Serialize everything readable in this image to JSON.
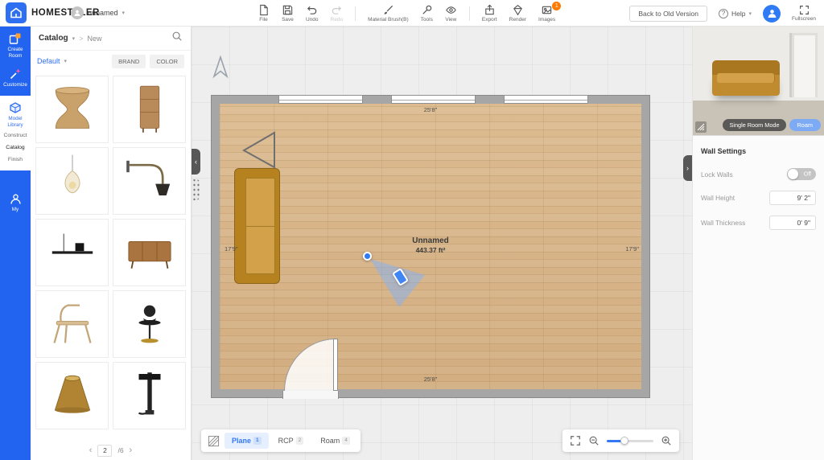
{
  "topbar": {
    "logo_text": "HOMESTYLER",
    "doc_name": "unnamed",
    "tools": [
      {
        "label": "File"
      },
      {
        "label": "Save"
      },
      {
        "label": "Undo"
      },
      {
        "label": "Redo"
      },
      {
        "label": "Material Brush(B)"
      },
      {
        "label": "Tools"
      },
      {
        "label": "View"
      },
      {
        "label": "Export"
      },
      {
        "label": "Render"
      },
      {
        "label": "Images",
        "badge": "1"
      }
    ],
    "back_button_label": "Back to Old Version",
    "help_label": "Help",
    "fullscreen_label": "Fullscreen"
  },
  "rail": {
    "items": [
      {
        "label": "Create Room"
      },
      {
        "label": "Customize"
      },
      {
        "label": "Model Library"
      },
      {
        "label": "Construct"
      },
      {
        "label": "Catalog"
      },
      {
        "label": "Finish"
      },
      {
        "label": "My"
      }
    ]
  },
  "catalog_panel": {
    "breadcrumb_root": "Catalog",
    "breadcrumb_sep": ">",
    "breadcrumb_current": "New",
    "sort_label": "Default",
    "tab_brand": "BRAND",
    "tab_color": "COLOR",
    "item_names": [
      "hourglass-rattan-stool",
      "tall-wood-cabinet",
      "glass-pendant-lamp",
      "brass-arm-wall-lamp",
      "black-linear-ceiling-lamp",
      "walnut-sideboard",
      "light-wood-chair",
      "sculpture-side-table",
      "bronze-cone-stool",
      "black-industrial-wall-lamp"
    ],
    "pagination": {
      "prev": "‹",
      "page": "2",
      "total": "/6",
      "next": "›"
    }
  },
  "canvas": {
    "room_name": "Unnamed",
    "room_area": "443.37 ft²",
    "dim_top": "25'8\"",
    "dim_bottom": "25'8\"",
    "dim_left": "17'9\"",
    "dim_right": "17'9\"",
    "view_tabs": [
      {
        "label": "Plane",
        "badge": "1"
      },
      {
        "label": "RCP",
        "badge": "2"
      },
      {
        "label": "Roam",
        "badge": "4"
      }
    ]
  },
  "preview": {
    "mode_button_label": "Single Room Mode",
    "roam_button_label": "Roam"
  },
  "wall_settings": {
    "title": "Wall Settings",
    "lock_label": "Lock Walls",
    "lock_state": "Off",
    "height_label": "Wall Height",
    "height_value": "9' 2\"",
    "thickness_label": "Wall Thickness",
    "thickness_value": "0' 9\""
  },
  "colors": {
    "accent_blue": "#2f6ff2",
    "rail_blue": "#2263ef",
    "sofa_mustard": "#c6913a",
    "wall_gray": "#a6a6a6",
    "badge_orange": "#ff7a00"
  }
}
